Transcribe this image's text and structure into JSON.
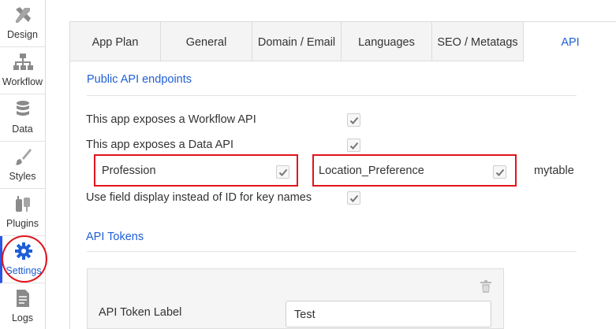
{
  "sidebar": {
    "items": [
      {
        "label": "Design",
        "icon": "design-icon"
      },
      {
        "label": "Workflow",
        "icon": "workflow-icon"
      },
      {
        "label": "Data",
        "icon": "database-icon"
      },
      {
        "label": "Styles",
        "icon": "brush-icon"
      },
      {
        "label": "Plugins",
        "icon": "plug-icon"
      },
      {
        "label": "Settings",
        "icon": "gear-icon",
        "active": true
      },
      {
        "label": "Logs",
        "icon": "document-icon"
      }
    ]
  },
  "tabs": [
    "App Plan",
    "General",
    "Domain / Email",
    "Languages",
    "SEO / Metatags",
    "API"
  ],
  "active_tab": "API",
  "public_api": {
    "title": "Public API endpoints",
    "workflow_label": "This app exposes a Workflow API",
    "workflow_checked": true,
    "data_label": "This app exposes a Data API",
    "data_checked": true,
    "fields": [
      {
        "name": "Profession",
        "checked": true
      },
      {
        "name": "Location_Preference",
        "checked": true
      }
    ],
    "table_label": "mytable",
    "field_display_label": "Use field display instead of ID for key names",
    "field_display_checked": true
  },
  "api_tokens": {
    "title": "API Tokens",
    "token_label": "API Token Label",
    "token_value": "Test",
    "delete_icon": "trash-icon"
  },
  "colors": {
    "accent": "#1e5fd6",
    "highlight_red": "#e0141c"
  }
}
